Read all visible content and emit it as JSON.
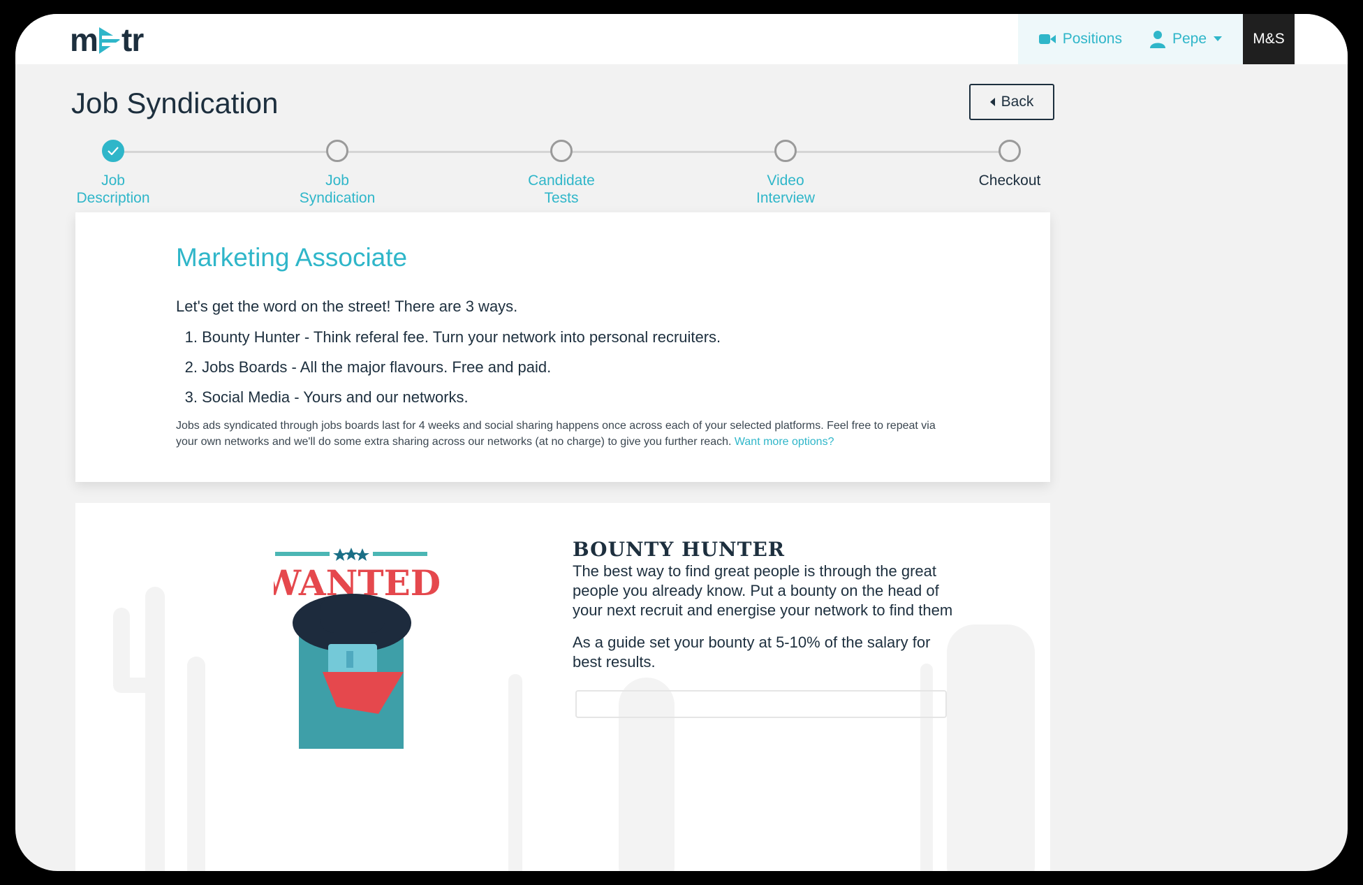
{
  "topbar": {
    "logo_text": "meetr",
    "positions_label": "Positions",
    "user_label": "Pepe",
    "company_label": "M&S"
  },
  "page": {
    "title": "Job Syndication",
    "back_label": "Back"
  },
  "stepper": {
    "steps": [
      {
        "line1": "Job",
        "line2": "Description",
        "status": "complete"
      },
      {
        "line1": "Job",
        "line2": "Syndication",
        "status": "pending"
      },
      {
        "line1": "Candidate",
        "line2": "Tests",
        "status": "pending"
      },
      {
        "line1": "Video",
        "line2": "Interview",
        "status": "pending"
      },
      {
        "line1": "Checkout",
        "line2": "",
        "status": "pending"
      }
    ]
  },
  "job_card": {
    "title": "Marketing Associate",
    "intro": "Let's get the word on the street! There are 3 ways.",
    "ways": [
      {
        "num": "1.",
        "text": "Bounty Hunter - Think referal fee. Turn your network into personal recruiters."
      },
      {
        "num": "2.",
        "text": "Jobs Boards - All the major flavours. Free and paid."
      },
      {
        "num": "3.",
        "text": "Social Media - Yours and our networks."
      }
    ],
    "note": "Jobs ads syndicated through jobs boards last for 4 weeks and social sharing happens once across each of your selected platforms. Feel free to repeat via your own networks and we'll do some extra sharing across our networks (at no charge) to give you further reach.",
    "note_link": "Want more options?"
  },
  "bounty_card": {
    "poster_text": "WANTED",
    "title": "BOUNTY HUNTER",
    "text": "The best way to find great people is through the great people you already know. Put a bounty on the head of your next recruit and energise your network to find them",
    "guide": "As a guide set your bounty at 5-10% of the salary for best results."
  },
  "colors": {
    "accent": "#2fb6c9",
    "dark": "#1d2f3e",
    "background": "#f2f2f2",
    "wanted_red": "#e5484d"
  }
}
